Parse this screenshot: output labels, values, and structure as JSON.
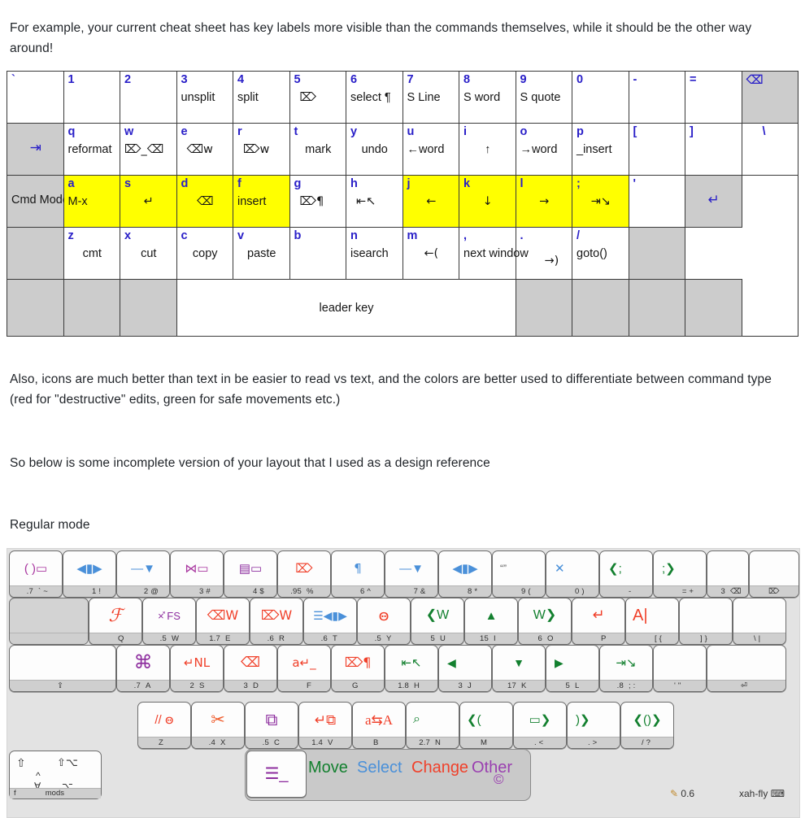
{
  "paragraphs": {
    "p1": "For example, your current cheat sheet has key labels more visible than the commands themselves, while it should be the other way around!",
    "p2": "Also, icons are much better than text in be easier to read vs text, and the colors are better used to differentiate between command type (red for \"destructive\" edits, green for safe movements etc.)",
    "p3": "So below is some incomplete version of your layout that I used as a design reference",
    "p4": "Regular mode"
  },
  "cheat_table": {
    "rows": [
      {
        "name": "number-row",
        "cells": [
          {
            "label": "`",
            "cmd": "",
            "style": "white",
            "name": "key-backtick"
          },
          {
            "label": "1",
            "cmd": "",
            "style": "white",
            "name": "key-1"
          },
          {
            "label": "2",
            "cmd": "",
            "style": "white",
            "name": "key-2"
          },
          {
            "label": "3",
            "cmd": "unsplit",
            "style": "white",
            "name": "key-3"
          },
          {
            "label": "4",
            "cmd": "split",
            "style": "white",
            "name": "key-4"
          },
          {
            "label": "5",
            "cmd": "⌦",
            "style": "white",
            "name": "key-5"
          },
          {
            "label": "6",
            "cmd": "select ¶",
            "style": "white",
            "name": "key-6"
          },
          {
            "label": "7",
            "cmd": "S Line",
            "style": "white",
            "name": "key-7"
          },
          {
            "label": "8",
            "cmd": "S word",
            "style": "white",
            "name": "key-8"
          },
          {
            "label": "9",
            "cmd": "S quote",
            "style": "white",
            "name": "key-9"
          },
          {
            "label": "0",
            "cmd": "",
            "style": "white",
            "name": "key-0"
          },
          {
            "label": "-",
            "cmd": "",
            "style": "white",
            "name": "key-minus"
          },
          {
            "label": "=",
            "cmd": "",
            "style": "white",
            "name": "key-equal"
          },
          {
            "label": "⌫",
            "cmd": "",
            "style": "grey-icon",
            "name": "key-backspace"
          }
        ]
      },
      {
        "name": "q-row",
        "cells": [
          {
            "label": "⇥",
            "cmd": "",
            "style": "grey-icon",
            "name": "key-tab"
          },
          {
            "label": "q",
            "cmd": "reformat",
            "style": "white",
            "name": "key-q"
          },
          {
            "label": "w",
            "cmd": "⌦_⌫",
            "style": "white",
            "name": "key-w"
          },
          {
            "label": "e",
            "cmd": "⌫w",
            "style": "white",
            "name": "key-e"
          },
          {
            "label": "r",
            "cmd": "⌦w",
            "style": "white",
            "name": "key-r"
          },
          {
            "label": "t",
            "cmd": "mark",
            "style": "white",
            "name": "key-t"
          },
          {
            "label": "y",
            "cmd": "undo",
            "style": "white",
            "name": "key-y"
          },
          {
            "label": "u",
            "cmd": "←word",
            "style": "white",
            "name": "key-u"
          },
          {
            "label": "i",
            "cmd": "↑",
            "style": "white",
            "name": "key-i"
          },
          {
            "label": "o",
            "cmd": "→word",
            "style": "white",
            "name": "key-o"
          },
          {
            "label": "p",
            "cmd": "_insert",
            "style": "white",
            "name": "key-p"
          },
          {
            "label": "[",
            "cmd": "",
            "style": "white",
            "name": "key-lbracket"
          },
          {
            "label": "]",
            "cmd": "",
            "style": "white",
            "name": "key-rbracket"
          },
          {
            "label": "\\",
            "cmd": "",
            "style": "white",
            "name": "key-backslash"
          }
        ]
      },
      {
        "name": "home-row",
        "cells": [
          {
            "label": "Cmd Mode",
            "cmd": "",
            "style": "grey-label",
            "name": "key-capslock-cmd-mode"
          },
          {
            "label": "a",
            "cmd": "M-x",
            "style": "yellow",
            "name": "key-a"
          },
          {
            "label": "s",
            "cmd": "↵",
            "style": "yellow",
            "name": "key-s"
          },
          {
            "label": "d",
            "cmd": "⌫",
            "style": "yellow",
            "name": "key-d"
          },
          {
            "label": "f",
            "cmd": "insert",
            "style": "yellow",
            "name": "key-f"
          },
          {
            "label": "g",
            "cmd": "⌦¶",
            "style": "white",
            "name": "key-g"
          },
          {
            "label": "h",
            "cmd": "⇤↖",
            "style": "white",
            "name": "key-h"
          },
          {
            "label": "j",
            "cmd": "←",
            "style": "yellow",
            "name": "key-j"
          },
          {
            "label": "k",
            "cmd": "↓",
            "style": "yellow",
            "name": "key-k"
          },
          {
            "label": "l",
            "cmd": "→",
            "style": "yellow",
            "name": "key-l"
          },
          {
            "label": ";",
            "cmd": "⇥↘",
            "style": "yellow",
            "name": "key-semicolon"
          },
          {
            "label": "'",
            "cmd": "",
            "style": "white",
            "name": "key-quote"
          },
          {
            "label": "↵",
            "cmd": "",
            "style": "grey-icon",
            "name": "key-return"
          }
        ]
      },
      {
        "name": "z-row",
        "cells": [
          {
            "label": "",
            "cmd": "",
            "style": "grey",
            "name": "key-shift-left"
          },
          {
            "label": "z",
            "cmd": "cmt",
            "style": "white",
            "name": "key-z"
          },
          {
            "label": "x",
            "cmd": "cut",
            "style": "white",
            "name": "key-x"
          },
          {
            "label": "c",
            "cmd": "copy",
            "style": "white",
            "name": "key-c"
          },
          {
            "label": "v",
            "cmd": "paste",
            "style": "white",
            "name": "key-v"
          },
          {
            "label": "b",
            "cmd": "",
            "style": "white",
            "name": "key-b"
          },
          {
            "label": "n",
            "cmd": "isearch",
            "style": "white",
            "name": "key-n"
          },
          {
            "label": "m",
            "cmd": "←(",
            "style": "white",
            "name": "key-m"
          },
          {
            "label": ",",
            "cmd": "next window",
            "style": "white",
            "name": "key-comma"
          },
          {
            "label": ".",
            "cmd": "→)",
            "style": "white",
            "name": "key-period"
          },
          {
            "label": "/",
            "cmd": "goto()",
            "style": "white",
            "name": "key-slash"
          },
          {
            "label": "",
            "cmd": "",
            "style": "grey",
            "name": "key-shift-right"
          }
        ]
      },
      {
        "name": "space-row",
        "cells": [
          {
            "label": "",
            "cmd": "",
            "style": "grey",
            "name": "key-ctrl-left"
          },
          {
            "label": "",
            "cmd": "",
            "style": "grey",
            "name": "key-meta-left"
          },
          {
            "label": "",
            "cmd": "",
            "style": "grey",
            "name": "key-alt-left"
          },
          {
            "label": "",
            "cmd": "leader key",
            "style": "white",
            "name": "key-space-leader"
          },
          {
            "label": "",
            "cmd": "",
            "style": "grey",
            "name": "key-alt-right"
          },
          {
            "label": "",
            "cmd": "",
            "style": "grey",
            "name": "key-meta-right"
          },
          {
            "label": "",
            "cmd": "",
            "style": "grey",
            "name": "key-fn"
          },
          {
            "label": "",
            "cmd": "",
            "style": "grey",
            "name": "key-ctrl-right"
          }
        ]
      }
    ]
  },
  "xah_keyboard": {
    "title": "Regular mode",
    "brand": "xah-fly",
    "version": "0.6",
    "legend_words": [
      {
        "text": "Move",
        "color": "#13802f"
      },
      {
        "text": "Select",
        "color": "#4a90d9"
      },
      {
        "text": "Change",
        "color": "#f0402a"
      },
      {
        "text": "Other",
        "color": "#9a3fb0"
      }
    ],
    "copyright": "©",
    "mods_label": "mods",
    "mods_left": "⇧",
    "mods_fn": "f",
    "rows": [
      {
        "name": "row-number",
        "keys": [
          {
            "name": "key-backtick",
            "glyph": "( )▭",
            "color": "#a8359f",
            "num": ".7",
            "key": "` ~"
          },
          {
            "name": "key-1",
            "glyph": "◀▮▶",
            "color": "#4a90d9",
            "num": "",
            "key": "1 !"
          },
          {
            "name": "key-2",
            "glyph": "—▼",
            "color": "#4a90d9",
            "num": "",
            "key": "2 @"
          },
          {
            "name": "key-3",
            "glyph": "⋈▭",
            "color": "#a8359f",
            "num": "",
            "key": "3 #"
          },
          {
            "name": "key-4",
            "glyph": "▤▭",
            "color": "#8d2d9e",
            "num": "",
            "key": "4 $"
          },
          {
            "name": "key-5",
            "glyph": "⌦",
            "color": "#f0402a",
            "num": ".95",
            "key": "%"
          },
          {
            "name": "key-6",
            "glyph": "¶",
            "color": "#4a90d9",
            "num": "",
            "key": "6 ^"
          },
          {
            "name": "key-7",
            "glyph": "—▼",
            "color": "#4a90d9",
            "num": "",
            "key": "7 &"
          },
          {
            "name": "key-8",
            "glyph": "◀▮▶",
            "color": "#4a90d9",
            "num": "",
            "key": "8 *"
          },
          {
            "name": "key-9",
            "glyph": "“”",
            "color": "#555555",
            "num": "",
            "key": "9 ("
          },
          {
            "name": "key-0",
            "glyph": "✕",
            "color": "#4a90d9",
            "num": "",
            "key": "0 )"
          },
          {
            "name": "key-minus",
            "glyph": "❮;",
            "color": "#13802f",
            "num": "",
            "key": "-"
          },
          {
            "name": "key-equal",
            "glyph": ";❯",
            "color": "#13802f",
            "num": "",
            "key": "= +"
          },
          {
            "name": "key-backspace-1",
            "glyph": "",
            "color": "#333333",
            "num": "3",
            "key": "⌫"
          },
          {
            "name": "key-backspace-2",
            "glyph": "",
            "color": "#333333",
            "num": "",
            "key": "⌦"
          }
        ]
      },
      {
        "name": "row-q",
        "keys": [
          {
            "name": "key-tab",
            "glyph": "",
            "color": "",
            "num": "",
            "key": ""
          },
          {
            "name": "key-q",
            "glyph": "ℱ",
            "color": "#f0402a",
            "num": "",
            "key": "Q"
          },
          {
            "name": "key-w",
            "glyph": "×̽ FS",
            "color": "#8d2d9e",
            "num": ".5",
            "key": "W"
          },
          {
            "name": "key-e",
            "glyph": "⌫W",
            "color": "#f0402a",
            "num": "1.7",
            "key": "E"
          },
          {
            "name": "key-r",
            "glyph": "⌦W",
            "color": "#f0402a",
            "num": ".6",
            "key": "R"
          },
          {
            "name": "key-t",
            "glyph": "☰◀▮▶",
            "color": "#4a90d9",
            "num": ".6",
            "key": "T"
          },
          {
            "name": "key-y",
            "glyph": "ꙫ",
            "color": "#f0402a",
            "num": ".5",
            "key": "Y"
          },
          {
            "name": "key-u",
            "glyph": "❮W",
            "color": "#13802f",
            "num": "5",
            "key": "U"
          },
          {
            "name": "key-i",
            "glyph": "▲",
            "color": "#13802f",
            "num": "15",
            "key": "I"
          },
          {
            "name": "key-o",
            "glyph": "W❯",
            "color": "#13802f",
            "num": "6",
            "key": "O"
          },
          {
            "name": "key-p",
            "glyph": "↵",
            "color": "#f0402a",
            "num": "",
            "key": "P"
          },
          {
            "name": "key-lbracket",
            "glyph": "A|",
            "color": "#f0402a",
            "num": "",
            "key": "[ {"
          },
          {
            "name": "key-rbracket",
            "glyph": "",
            "color": "",
            "num": "",
            "key": "] }"
          },
          {
            "name": "key-backslash",
            "glyph": "",
            "color": "",
            "num": "",
            "key": "\\ |"
          }
        ]
      },
      {
        "name": "row-home",
        "keys": [
          {
            "name": "key-capslock",
            "glyph": "",
            "color": "",
            "num": "",
            "key": "⇪"
          },
          {
            "name": "key-a",
            "glyph": "⌘",
            "color": "#8d2d9e",
            "num": ".7",
            "key": "A"
          },
          {
            "name": "key-s",
            "glyph": "↵NL",
            "color": "#f0402a",
            "num": "2",
            "key": "S"
          },
          {
            "name": "key-d",
            "glyph": "⌫",
            "color": "#f0402a",
            "num": "3",
            "key": "D"
          },
          {
            "name": "key-f",
            "glyph": "a↵_",
            "color": "#f0402a",
            "num": "",
            "key": "F"
          },
          {
            "name": "key-g",
            "glyph": "⌦¶",
            "color": "#f0402a",
            "num": "",
            "key": "G"
          },
          {
            "name": "key-h",
            "glyph": "⇤↖",
            "color": "#13802f",
            "num": "1.8",
            "key": "H"
          },
          {
            "name": "key-j",
            "glyph": "◀",
            "color": "#13802f",
            "num": "3",
            "key": "J"
          },
          {
            "name": "key-k",
            "glyph": "▼",
            "color": "#13802f",
            "num": "17",
            "key": "K"
          },
          {
            "name": "key-l",
            "glyph": "▶",
            "color": "#13802f",
            "num": "5",
            "key": "L"
          },
          {
            "name": "key-semicolon",
            "glyph": "⇥↘",
            "color": "#13802f",
            "num": ".8",
            "key": "; :"
          },
          {
            "name": "key-quote",
            "glyph": "",
            "color": "",
            "num": "",
            "key": "' \""
          },
          {
            "name": "key-return",
            "glyph": "",
            "color": "",
            "num": "",
            "key": "⏎"
          }
        ]
      },
      {
        "name": "row-z",
        "keys": [
          {
            "name": "key-z",
            "glyph": "// ꙫ",
            "color": "#f0402a",
            "num": "",
            "key": "Z"
          },
          {
            "name": "key-x",
            "glyph": "✂",
            "color": "#f0402a",
            "num": ".4",
            "key": "X"
          },
          {
            "name": "key-c",
            "glyph": "⧉",
            "color": "#8d2d9e",
            "num": ".5",
            "key": "C"
          },
          {
            "name": "key-v",
            "glyph": "↵⧉",
            "color": "#f0402a",
            "num": "1.4",
            "key": "V"
          },
          {
            "name": "key-b",
            "glyph": "a⇆A",
            "color": "#f0402a",
            "num": "",
            "key": "B"
          },
          {
            "name": "key-n",
            "glyph": "⌕",
            "color": "#13802f",
            "num": "2.7",
            "key": "N"
          },
          {
            "name": "key-m",
            "glyph": "❮(",
            "color": "#13802f",
            "num": "",
            "key": "M"
          },
          {
            "name": "key-comma",
            "glyph": "▭❯",
            "color": "#13802f",
            "num": "",
            "key": ". <"
          },
          {
            "name": "key-period",
            "glyph": ")❯",
            "color": "#13802f",
            "num": "",
            "key": ". >"
          },
          {
            "name": "key-slash",
            "glyph": "❮()❯",
            "color": "#13802f",
            "num": "",
            "key": "/ ?"
          }
        ]
      },
      {
        "name": "row-space",
        "keys": [
          {
            "name": "key-space",
            "glyph": "☰_",
            "color": "#8d2d9e",
            "num": "",
            "key": ""
          }
        ]
      }
    ]
  }
}
